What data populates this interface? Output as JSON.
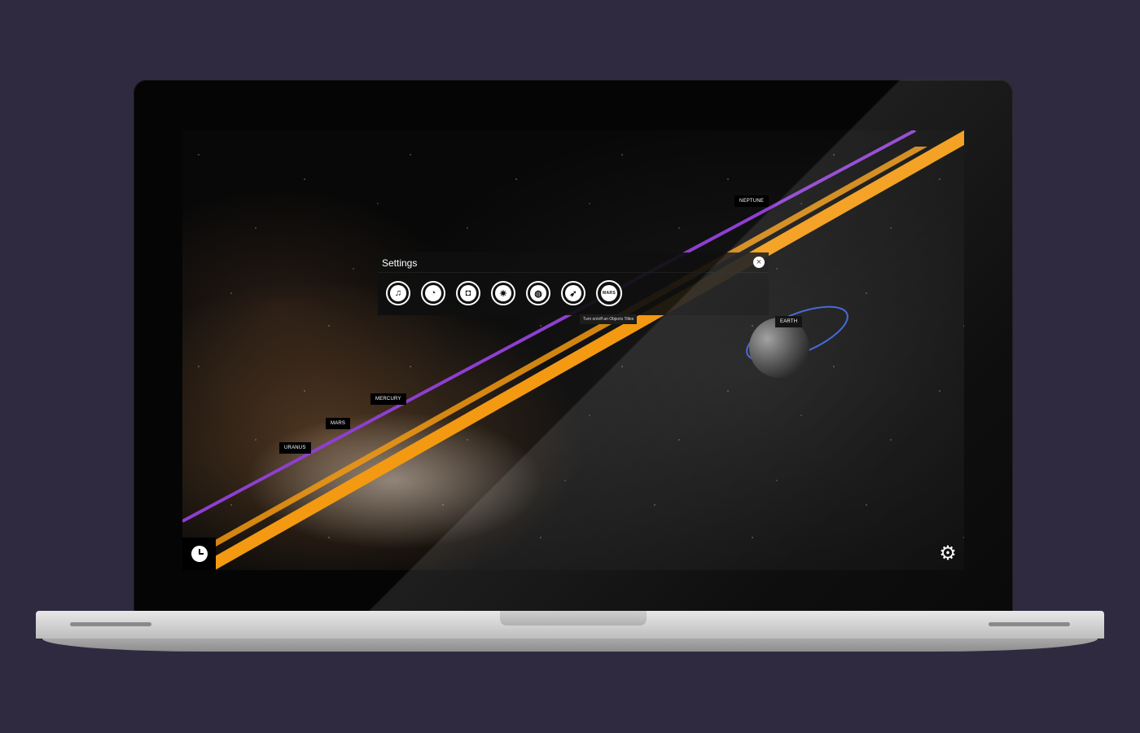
{
  "settings": {
    "title": "Settings",
    "close_glyph": "×",
    "buttons": [
      {
        "name": "music-icon",
        "glyph": "♫"
      },
      {
        "name": "orbits-icon",
        "glyph": "◔"
      },
      {
        "name": "3d-glasses-icon",
        "glyph": "◘"
      },
      {
        "name": "star-icon",
        "glyph": "✷"
      },
      {
        "name": "globe-icon",
        "glyph": "◍"
      },
      {
        "name": "rocket-icon",
        "glyph": "➶"
      },
      {
        "name": "mars-title-icon",
        "glyph": "MARS"
      }
    ],
    "tooltip": "Turn on/off an Objects Titles"
  },
  "planet_labels": {
    "neptune": "NEPTUNE",
    "earth": "EARTH",
    "mercury": "MERCURY",
    "mars": "MARS",
    "uranus": "URANUS"
  },
  "controls": {
    "clock_icon": "clock-icon",
    "gear_glyph": "⚙"
  },
  "colors": {
    "orbit_orange": "#f39a12",
    "orbit_purple": "#8e3fd0",
    "orbit_blue": "#3a5ed8",
    "background": "#302a40"
  }
}
